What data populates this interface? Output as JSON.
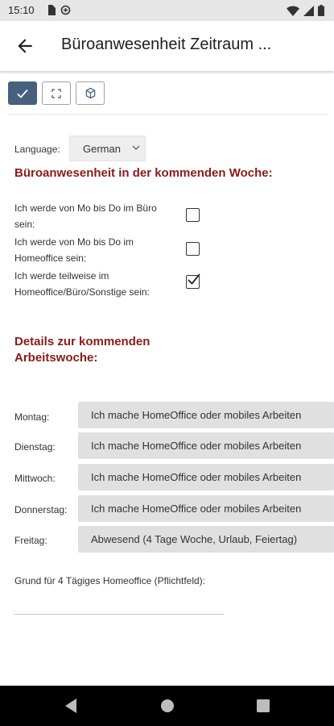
{
  "status_bar": {
    "time": "15:10",
    "left_icons": [
      "sim-card-icon",
      "data-saver-icon"
    ],
    "right_icons": [
      "wifi-icon",
      "signal-icon",
      "battery-icon"
    ]
  },
  "app_bar": {
    "title": "Büroanwesenheit Zeitraum ...",
    "back_icon": "arrow-left-icon"
  },
  "toolbar": {
    "buttons": [
      {
        "icon": "check-icon",
        "active": true
      },
      {
        "icon": "fullscreen-icon",
        "active": false
      },
      {
        "icon": "cube-icon",
        "active": false
      }
    ]
  },
  "language": {
    "label": "Language:",
    "selected": "German"
  },
  "section1": {
    "title": "Büroanwesenheit in der kommenden Woche:",
    "options": [
      {
        "label": "Ich werde von Mo bis Do im Büro sein:",
        "checked": false
      },
      {
        "label": "Ich werde von Mo bis Do im Homeoffice sein:",
        "checked": false
      },
      {
        "label": "Ich werde teilweise im Homeoffice/Büro/Sonstige sein:",
        "checked": true
      }
    ]
  },
  "section2": {
    "title": "Details zur kommenden Arbeitswoche:",
    "days": [
      {
        "label": "Montag:",
        "value": "Ich mache HomeOffice oder mobiles Arbeiten"
      },
      {
        "label": "Dienstag:",
        "value": "Ich mache HomeOffice oder mobiles Arbeiten"
      },
      {
        "label": "Mittwoch:",
        "value": "Ich mache HomeOffice oder mobiles Arbeiten"
      },
      {
        "label": "Donnerstag:",
        "value": "Ich mache HomeOffice oder mobiles Arbeiten"
      },
      {
        "label": "Freitag:",
        "value": "Abwesend (4 Tage Woche, Urlaub, Feiertag)"
      }
    ]
  },
  "reason": {
    "label": "Grund für 4 Tägiges Homeoffice (Pflichtfeld):",
    "value": ""
  },
  "colors": {
    "accent": "#8b1a1a",
    "toolbar_active": "#46607e",
    "field_bg": "#e0e0e0"
  },
  "nav_bar": {
    "buttons": [
      "back-triangle-icon",
      "home-circle-icon",
      "recents-square-icon"
    ]
  }
}
